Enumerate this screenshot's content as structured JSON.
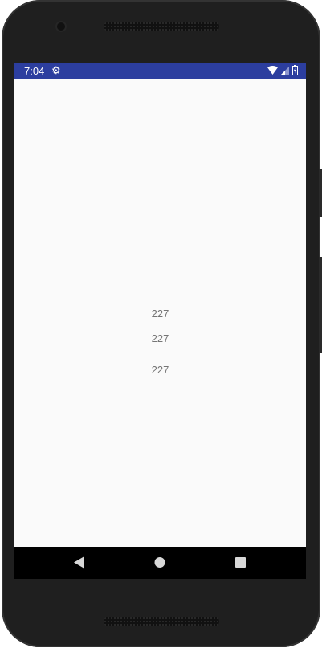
{
  "status_bar": {
    "time": "7:04",
    "settings_icon": "gear-icon",
    "wifi_icon": "wifi-icon",
    "signal_icon": "signal-icon",
    "battery_icon": "battery-icon",
    "color": "#2c3e9f"
  },
  "content": {
    "values": [
      "227",
      "227",
      "227"
    ]
  },
  "nav_bar": {
    "back_icon": "back-icon",
    "home_icon": "home-icon",
    "recents_icon": "recents-icon"
  }
}
